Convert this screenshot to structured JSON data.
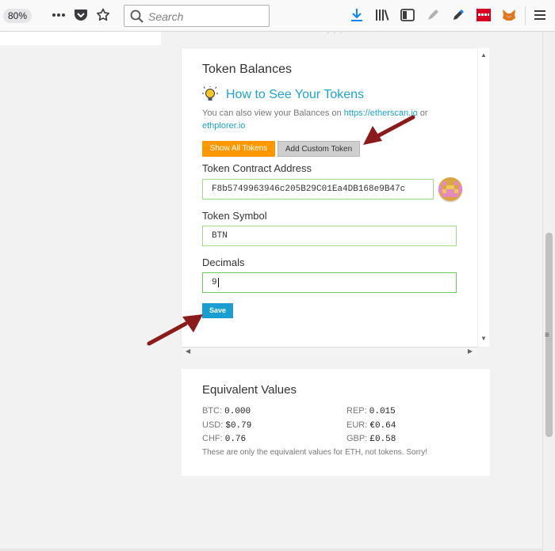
{
  "browser": {
    "zoom": "80%",
    "search_placeholder": "Search",
    "icons": [
      "more-icon",
      "pocket-icon",
      "bookmark-star-icon",
      "search-icon",
      "download-icon",
      "library-icon",
      "sidebar-icon",
      "pen-icon",
      "eyedropper-icon",
      "extension-red-icon",
      "metamask-fox-icon",
      "hamburger-menu-icon"
    ]
  },
  "token_balances": {
    "title": "Token Balances",
    "howto_link": "How to See Your Tokens",
    "info_prefix": "You can also view your Balances on ",
    "etherscan": "https://etherscan.io",
    "info_or": " or",
    "ethplorer": "ethplorer.io",
    "show_all_label": "Show All Tokens",
    "add_custom_label": "Add Custom Token",
    "contract_label": "Token Contract Address",
    "contract_value": "F8b5749963946c205B29C01Ea4DB168e9B47c",
    "symbol_label": "Token Symbol",
    "symbol_value": "BTN",
    "decimals_label": "Decimals",
    "decimals_value": "9",
    "save_label": "Save"
  },
  "equivalent_values": {
    "title": "Equivalent Values",
    "btc_label": "BTC:",
    "btc": "0.000",
    "rep_label": "REP:",
    "rep": "0.015",
    "usd_label": "USD:",
    "usd": "$0.79",
    "eur_label": "EUR:",
    "eur": "€0.64",
    "chf_label": "CHF:",
    "chf": "0.76",
    "gbp_label": "GBP:",
    "gbp": "£0.58",
    "note": "These are only the equivalent values for ETH, not tokens. Sorry!"
  },
  "colors": {
    "accent_link": "#21a4ce",
    "show_all_bg": "#ff9800",
    "save_bg": "#1a9ed1",
    "arrow": "#8b1a1a",
    "field_border": "#9fd98a"
  }
}
